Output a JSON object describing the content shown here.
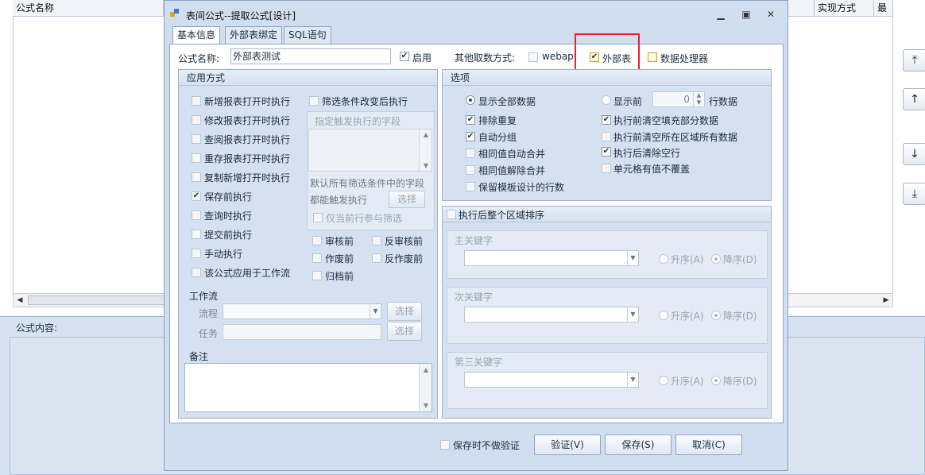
{
  "background": {
    "columns": [
      "公式名称",
      "实现方式",
      "最后"
    ],
    "content_label": "公式内容:",
    "side_buttons": [
      "top-icon",
      "up-icon",
      "down-icon",
      "bottom-icon"
    ]
  },
  "dialog": {
    "title": "表间公式--提取公式[设计]",
    "tabs": [
      "基本信息",
      "外部表绑定",
      "SQL语句"
    ],
    "formula_name_label": "公式名称:",
    "formula_name_value": "外部表测试",
    "enable_label": "启用",
    "other_source_label": "其他取数方式:",
    "source_options": [
      {
        "label": "webapi",
        "checked": false
      },
      {
        "label": "外部表",
        "checked": true
      },
      {
        "label": "数据处理器",
        "checked": false
      }
    ],
    "apply": {
      "title": "应用方式",
      "items": [
        {
          "label": "新增报表打开时执行",
          "checked": false
        },
        {
          "label": "修改报表打开时执行",
          "checked": false
        },
        {
          "label": "查阅报表打开时执行",
          "checked": false
        },
        {
          "label": "重存报表打开时执行",
          "checked": false
        },
        {
          "label": "复制新增打开时执行",
          "checked": false
        },
        {
          "label": "保存前执行",
          "checked": true
        },
        {
          "label": "查询时执行",
          "checked": false
        },
        {
          "label": "提交前执行",
          "checked": false
        },
        {
          "label": "手动执行",
          "checked": false
        },
        {
          "label": "该公式应用于工作流",
          "checked": false
        }
      ],
      "filter_change_label": "筛选条件改变后执行",
      "trigger_fields_title": "指定触发执行的字段",
      "default_hint_1": "默认所有筛选条件中的字段",
      "default_hint_2": "都能触发执行",
      "select_label": "选择",
      "current_row_label": "仅当前行参与筛选",
      "audit_items": [
        "审核前",
        "反审核前",
        "作废前",
        "反作废前",
        "归档前"
      ],
      "workflow_title": "工作流",
      "flow_label": "流程",
      "task_label": "任务",
      "flow_select": "选择",
      "task_select": "选择",
      "remark_title": "备注"
    },
    "options": {
      "title": "选项",
      "show_all": "显示全部数据",
      "show_top": "显示前",
      "top_value": "0",
      "row_data": "行数据",
      "left_items": [
        {
          "label": "排除重复",
          "checked": true
        },
        {
          "label": "自动分组",
          "checked": true
        },
        {
          "label": "相同值自动合并",
          "checked": false
        },
        {
          "label": "相同值解除合并",
          "checked": false
        },
        {
          "label": "保留模板设计的行数",
          "checked": false
        }
      ],
      "right_items": [
        {
          "label": "执行前清空填充部分数据",
          "checked": true
        },
        {
          "label": "执行前清空所在区域所有数据",
          "checked": false
        },
        {
          "label": "执行后清除空行",
          "checked": true
        },
        {
          "label": "单元格有值不覆盖",
          "checked": false
        }
      ]
    },
    "sort": {
      "title": "执行后整个区域排序",
      "keys": [
        "主关键字",
        "次关键字",
        "第三关键字"
      ],
      "asc": "升序(A)",
      "desc": "降序(D)"
    },
    "footer": {
      "no_validate": "保存时不做验证",
      "validate": "验证(V)",
      "save": "保存(S)",
      "cancel": "取消(C)"
    }
  }
}
